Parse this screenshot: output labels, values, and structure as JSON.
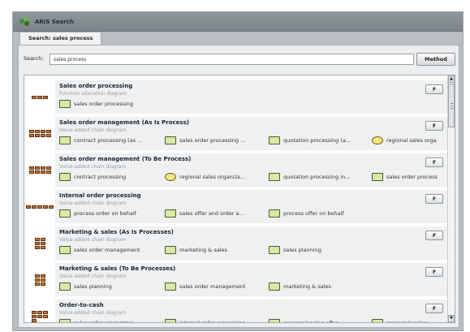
{
  "window": {
    "title": "ARIS Search"
  },
  "tab": {
    "label": "Search: sales process"
  },
  "search": {
    "label": "Search:",
    "value": "sales process",
    "method_label": "Method"
  },
  "results": [
    {
      "name": "Sales order processing",
      "type": "Function allocation diagram",
      "button": "F",
      "objects": [
        {
          "label": "sales order processing",
          "shape": "rect"
        }
      ]
    },
    {
      "name": "Sales order management (As Is Process)",
      "type": "Value-added chain diagram",
      "button": "F",
      "objects": [
        {
          "label": "contract processing (as ...",
          "shape": "rect"
        },
        {
          "label": "sales order processing ...",
          "shape": "rect"
        },
        {
          "label": "quotation processing (a...",
          "shape": "rect"
        },
        {
          "label": "regional sales orga",
          "shape": "oval"
        }
      ]
    },
    {
      "name": "Sales order management (To Be Process)",
      "type": "Value-added chain diagram",
      "button": "F",
      "objects": [
        {
          "label": "contract processing",
          "shape": "rect"
        },
        {
          "label": "regional sales organiza...",
          "shape": "oval"
        },
        {
          "label": "quotation processing in...",
          "shape": "rect"
        },
        {
          "label": "sales order process",
          "shape": "rect"
        }
      ]
    },
    {
      "name": "Internal order processing",
      "type": "Value-added chain diagram",
      "button": "F",
      "objects": [
        {
          "label": "process order on behalf",
          "shape": "rect"
        },
        {
          "label": "sales offer and order a...",
          "shape": "rect"
        },
        {
          "label": "process offer on behalf",
          "shape": "rect"
        }
      ]
    },
    {
      "name": "Marketing & sales (As Is Processes)",
      "type": "Value-added chain diagram",
      "button": "F",
      "objects": [
        {
          "label": "sales order management",
          "shape": "rect"
        },
        {
          "label": "marketing & sales",
          "shape": "rect"
        },
        {
          "label": "sales planning",
          "shape": "rect"
        }
      ]
    },
    {
      "name": "Marketing & sales (To Be Processes)",
      "type": "Value-added chain diagram",
      "button": "F",
      "objects": [
        {
          "label": "sales planning",
          "shape": "rect"
        },
        {
          "label": "sales order management",
          "shape": "rect"
        },
        {
          "label": "marketing & sales",
          "shape": "rect"
        }
      ]
    },
    {
      "name": "Order-to-cash",
      "type": "Value-added chain diagram",
      "button": "F",
      "objects": [
        {
          "label": "sales order processing",
          "shape": "rect"
        },
        {
          "label": "internal order processing",
          "shape": "rect"
        },
        {
          "label": "process leasing offer",
          "shape": "rect"
        },
        {
          "label": "process leasing",
          "shape": "rect"
        }
      ]
    }
  ],
  "scrollbar": {
    "up_glyph": "▲",
    "down_glyph": "▼"
  },
  "colors": {
    "object_fill": "#d8e8a6",
    "org_unit_fill": "#f5e680",
    "model_shape": "#c8762e"
  }
}
